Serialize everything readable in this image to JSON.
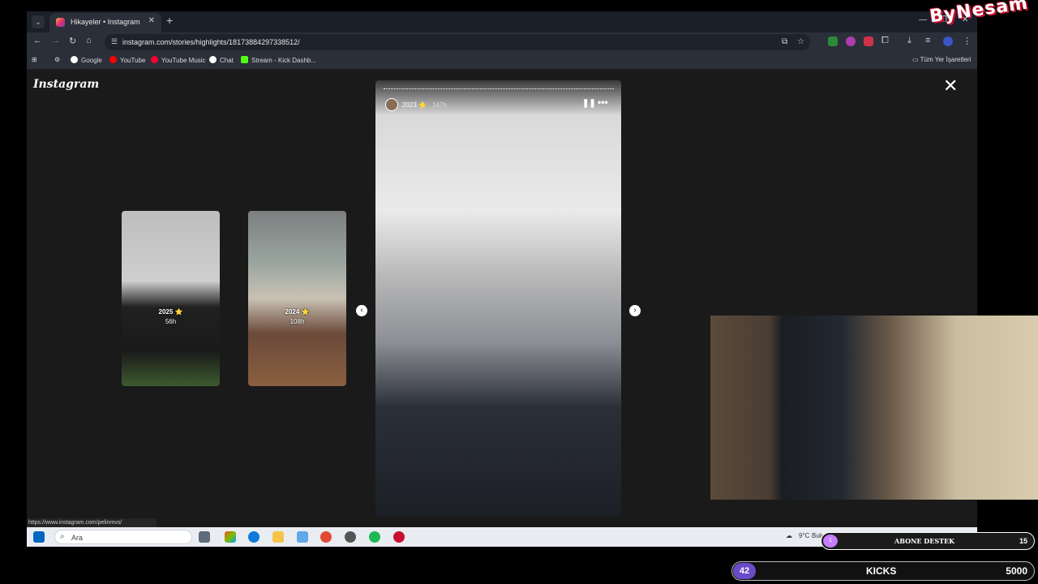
{
  "browser": {
    "tab_title": "Hikayeler • Instagram",
    "url": "instagram.com/stories/highlights/18173884297338512/",
    "bookmarks": [
      "Google",
      "YouTube",
      "YouTube Music",
      "Chat",
      "Stream - Kick Dashb..."
    ],
    "all_bookmarks": "Tüm Yer İşaretleri",
    "status_url": "https://www.instagram.com/pelinmvs/"
  },
  "instagram": {
    "logo": "Instagram",
    "stories": [
      {
        "title": "2025 ⭐",
        "age": "56h"
      },
      {
        "title": "2024 ⭐",
        "age": "108h"
      }
    ],
    "main_story": {
      "title": "2023 ⭐",
      "age": "147h"
    }
  },
  "taskbar": {
    "search_placeholder": "Ara",
    "weather": "9°C",
    "weather_condition": "Bulutlu"
  },
  "overlay": {
    "brand": "ByNesam",
    "abone_label": "ABONE DESTEK",
    "abone_count": "1",
    "abone_goal": "15",
    "kicks_count": "42",
    "kicks_label": "KICKS",
    "kicks_goal": "5000"
  },
  "colors": {
    "browser_chrome": "#2b2f3a",
    "ig_background": "#1a1a1a",
    "kicks_accent": "#6a4bc9",
    "abone_accent": "#c77dff"
  }
}
